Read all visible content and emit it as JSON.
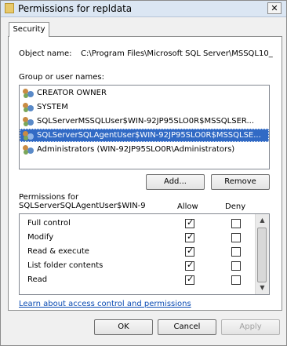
{
  "window": {
    "title": "Permissions for repldata",
    "close_glyph": "✕"
  },
  "tabs": [
    {
      "label": "Security"
    }
  ],
  "object": {
    "label": "Object name:",
    "value": "C:\\Program Files\\Microsoft SQL Server\\MSSQL10_"
  },
  "users": {
    "label": "Group or user names:",
    "items": [
      {
        "name": "CREATOR OWNER",
        "icon": "users-group-icon",
        "selected": false
      },
      {
        "name": "SYSTEM",
        "icon": "users-group-icon",
        "selected": false
      },
      {
        "name": "SQLServerMSSQLUser$WIN-92JP95SLO0R$MSSQLSER...",
        "icon": "users-group-icon",
        "selected": false
      },
      {
        "name": "SQLServerSQLAgentUser$WIN-92JP95SLO0R$MSSQLSE...",
        "icon": "users-group-icon",
        "selected": true
      },
      {
        "name": "Administrators (WIN-92JP95SLO0R\\Administrators)",
        "icon": "users-group-icon",
        "selected": false
      }
    ],
    "add_label": "Add...",
    "remove_label": "Remove"
  },
  "permissions": {
    "label_line1": "Permissions for",
    "label_line2": "SQLServerSQLAgentUser$WIN-9",
    "allow_header": "Allow",
    "deny_header": "Deny",
    "check_glyph": "✓",
    "rows": [
      {
        "name": "Full control",
        "allow": true,
        "deny": false
      },
      {
        "name": "Modify",
        "allow": true,
        "deny": false
      },
      {
        "name": "Read & execute",
        "allow": true,
        "deny": false
      },
      {
        "name": "List folder contents",
        "allow": true,
        "deny": false
      },
      {
        "name": "Read",
        "allow": true,
        "deny": false
      }
    ]
  },
  "learn_link": "Learn about access control and permissions",
  "footer": {
    "ok_label": "OK",
    "cancel_label": "Cancel",
    "apply_label": "Apply"
  },
  "scroll_glyphs": {
    "up": "▲",
    "down": "▼"
  },
  "colors": {
    "selection": "#316ac5",
    "link": "#0a4bb3",
    "titlebar": "#dbe6f3"
  }
}
